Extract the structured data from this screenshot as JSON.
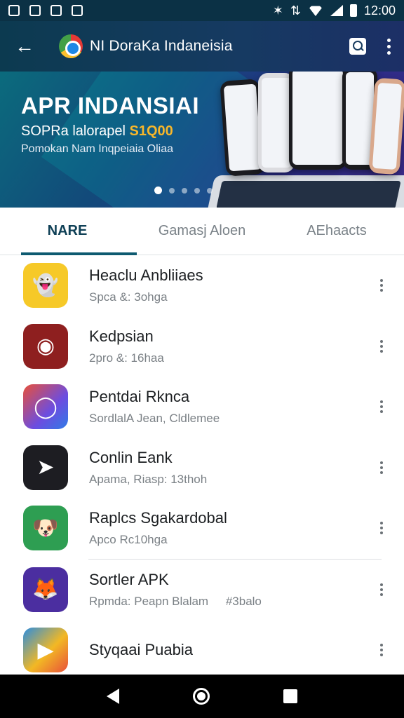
{
  "status_bar": {
    "time": "12:00"
  },
  "app_bar": {
    "title": "NI DoraKa Indaneisia"
  },
  "banner": {
    "title": "APR INDANSIAI",
    "subtitle": "SOPRa lalorapel",
    "price": "S1Q00",
    "caption": "Pomokan Nam Inqpeiaia Oliaa",
    "carousel_index": 1,
    "carousel_count": 5
  },
  "tabs": [
    {
      "label": "NARE",
      "active": true
    },
    {
      "label": "Gamasj Aloen",
      "active": false
    },
    {
      "label": "AEhaacts",
      "active": false
    }
  ],
  "apps": [
    {
      "name": "Heaclu Anbliiaes",
      "meta": "Spca &: 3ohga",
      "extra": "",
      "icon": "ghost-icon",
      "color": "#f6c928"
    },
    {
      "name": "Kedpsian",
      "meta": "2pro &: 16haa",
      "extra": "",
      "icon": "eye-icon",
      "color": "#8e1f1f"
    },
    {
      "name": "Pentdai Rknca",
      "meta": "SordlalA Jean, Cldlemee",
      "extra": "",
      "icon": "chat-icon",
      "color": "#6c4de0"
    },
    {
      "name": "Conlin Eank",
      "meta": "Apama, Riasp: 13thoh",
      "extra": "",
      "icon": "rocket-icon",
      "color": "#1d1d22"
    },
    {
      "name": "Raplcs Sgakardobal",
      "meta": "Apco Rc10hga",
      "extra": "",
      "icon": "dog-icon",
      "color": "#2e9e52"
    },
    {
      "name": "Sortler APK",
      "meta": "Rpmda: Peapn Blalam",
      "extra": "#3balo",
      "icon": "fox-icon",
      "color": "#4b2ea0"
    },
    {
      "name": "Styqaai Puabia",
      "meta": "",
      "extra": "",
      "icon": "play-icon",
      "color": "#2b8de0"
    }
  ]
}
